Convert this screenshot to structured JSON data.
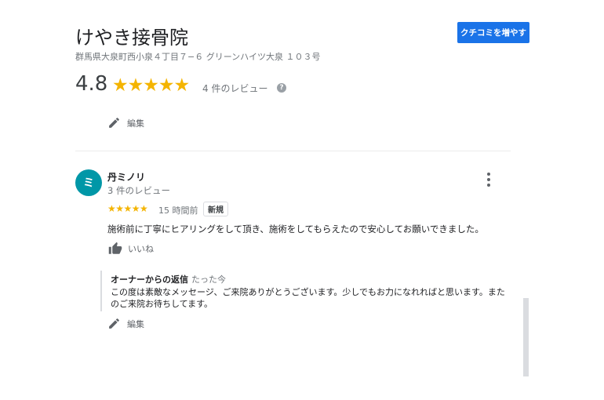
{
  "business": {
    "name": "けやき接骨院",
    "address": "群馬県大泉町西小泉４丁目７−６ グリーンハイツ大泉 １０３号",
    "cta_label": "クチコミを増やす",
    "rating": "4.8",
    "stars": "★★★★★",
    "review_count": "4 件のレビュー",
    "help_glyph": "?"
  },
  "top_edit": {
    "label": "編集"
  },
  "review": {
    "avatar_letter": "ミ",
    "avatar_color": "#0097a7",
    "author": "丹ミノリ",
    "author_reviews": "3 件のレビュー",
    "stars": "★★★★★",
    "time": "15 時間前",
    "badge": "新規",
    "text": "施術前に丁寧にヒアリングをして頂き、施術をしてもらえたので安心してお願いできました。",
    "like_label": "いいね",
    "reply": {
      "label": "オーナーからの返信",
      "time": "たった今",
      "text": "この度は素敵なメッセージ、ご来院ありがとうございます。少しでもお力になれればと思います。またのご来院お待ちしてます。"
    },
    "edit_label": "編集"
  },
  "colors": {
    "accent": "#1a73e8",
    "star": "#f4b400"
  },
  "icons": [
    "help-icon",
    "pencil-icon",
    "more-vert-icon",
    "thumbs-up-icon"
  ]
}
